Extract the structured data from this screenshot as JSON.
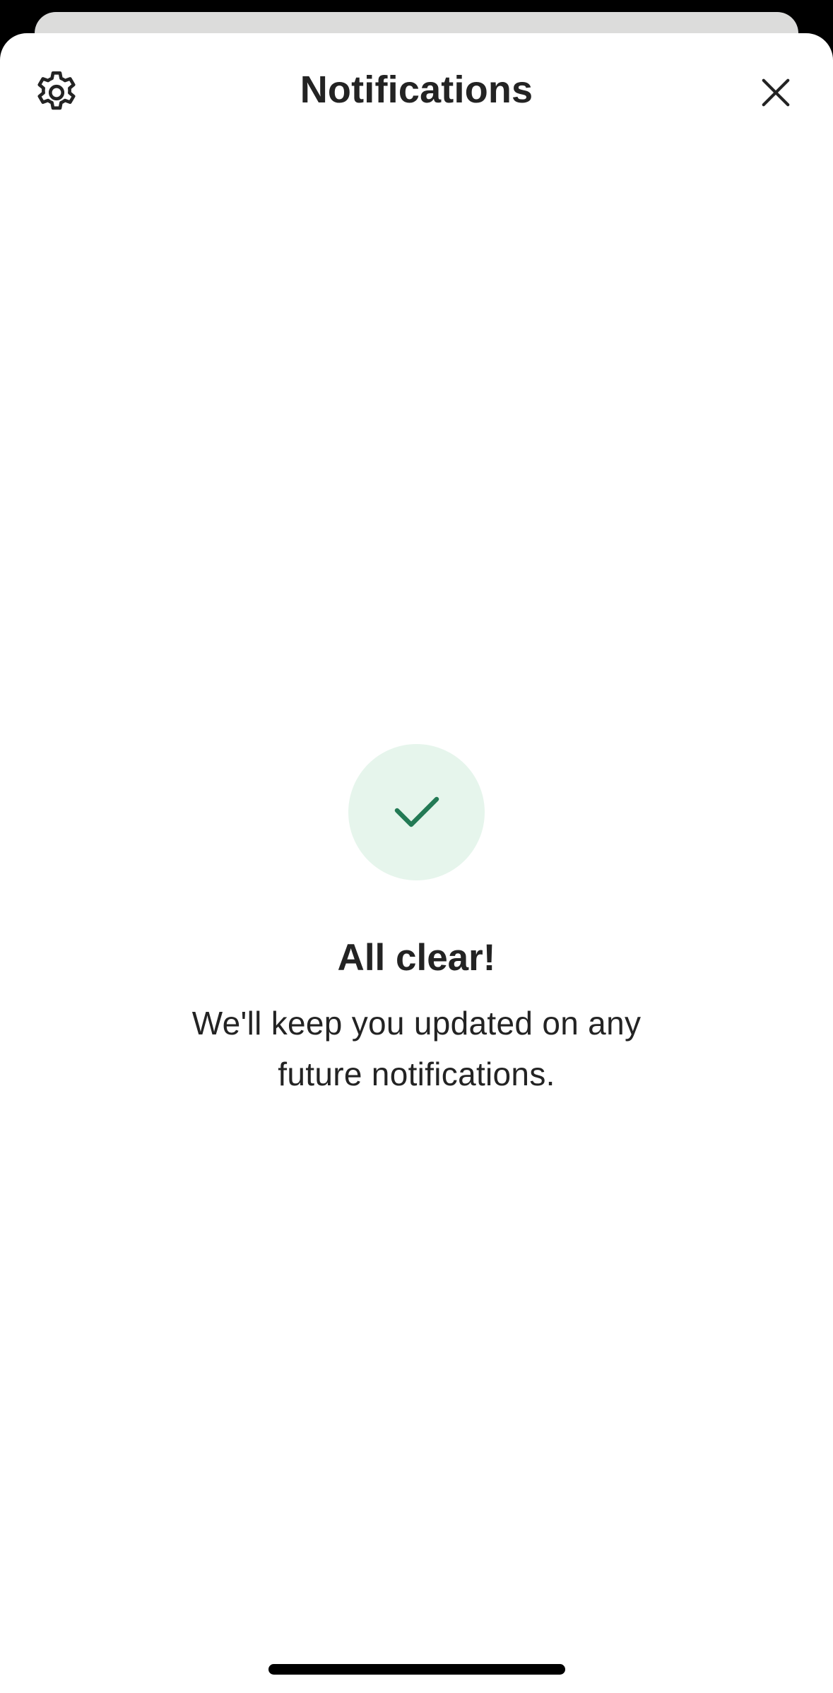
{
  "header": {
    "title": "Notifications",
    "settings_icon": "gear-icon",
    "close_icon": "close-icon"
  },
  "empty_state": {
    "icon": "checkmark-icon",
    "title": "All clear!",
    "message": "We'll keep you updated on any future notifications."
  },
  "colors": {
    "accent_green": "#237a55",
    "check_circle_bg": "#e6f5ec",
    "text_primary": "#232323",
    "sheet_bg": "#ffffff"
  }
}
